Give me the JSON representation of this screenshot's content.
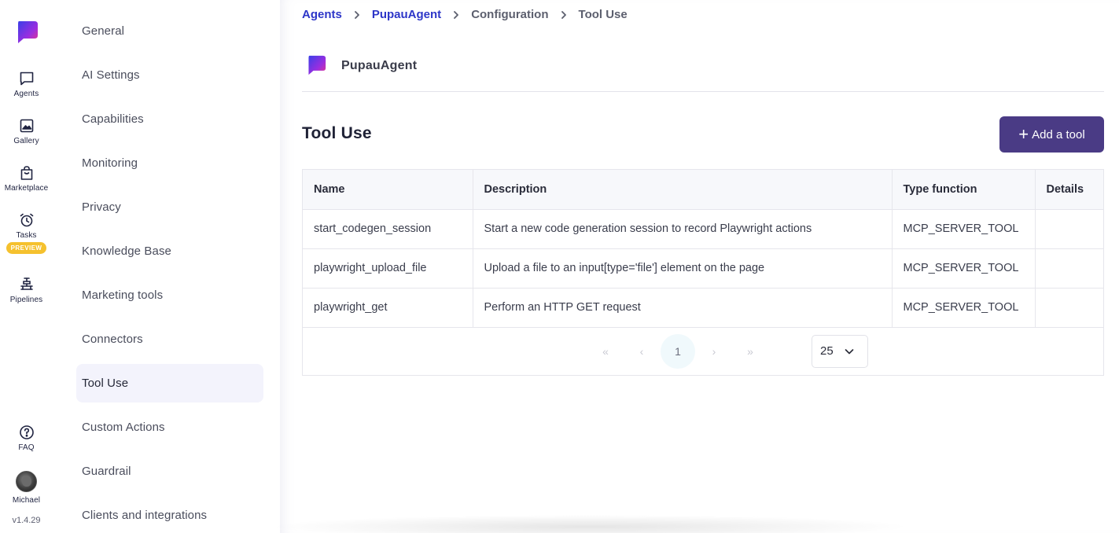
{
  "rail": {
    "items": [
      {
        "label": "Agents",
        "icon": "chat-bubble-icon"
      },
      {
        "label": "Gallery",
        "icon": "image-icon"
      },
      {
        "label": "Marketplace",
        "icon": "shopping-bag-icon"
      },
      {
        "label": "Tasks",
        "icon": "alarm-clock-icon",
        "badge": "PREVIEW"
      },
      {
        "label": "Pipelines",
        "icon": "pipeline-icon"
      }
    ],
    "faq_label": "FAQ",
    "user_name": "Michael",
    "version": "v1.4.29"
  },
  "menu": {
    "items": [
      {
        "label": "General"
      },
      {
        "label": "AI Settings"
      },
      {
        "label": "Capabilities"
      },
      {
        "label": "Monitoring"
      },
      {
        "label": "Privacy"
      },
      {
        "label": "Knowledge Base"
      },
      {
        "label": "Marketing tools"
      },
      {
        "label": "Connectors"
      },
      {
        "label": "Tool Use",
        "active": true
      },
      {
        "label": "Custom Actions"
      },
      {
        "label": "Guardrail"
      },
      {
        "label": "Clients and integrations"
      }
    ]
  },
  "breadcrumb": [
    "Agents",
    "PupauAgent",
    "Configuration",
    "Tool Use"
  ],
  "agent": {
    "name": "PupauAgent"
  },
  "page": {
    "title": "Tool Use",
    "add_button": "Add a tool"
  },
  "table": {
    "columns": [
      "Name",
      "Description",
      "Type function",
      "Details"
    ],
    "rows": [
      [
        "start_codegen_session",
        "Start a new code generation session to record Playwright actions",
        "MCP_SERVER_TOOL",
        ""
      ],
      [
        "playwright_upload_file",
        "Upload a file to an input[type='file'] element on the page",
        "MCP_SERVER_TOOL",
        ""
      ],
      [
        "playwright_get",
        "Perform an HTTP GET request",
        "MCP_SERVER_TOOL",
        ""
      ]
    ]
  },
  "pagination": {
    "first": "«",
    "prev": "‹",
    "current_page": "1",
    "next": "›",
    "last": "»",
    "page_size": "25"
  },
  "colors": {
    "accent": "#4a3b85",
    "link": "#2d36c8",
    "badge": "#f5c12e",
    "active_menu_bg": "#f3f3fc"
  }
}
